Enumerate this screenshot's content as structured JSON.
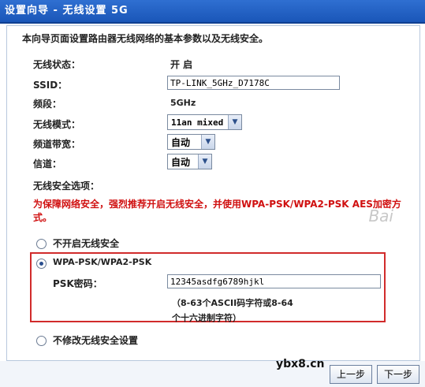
{
  "window": {
    "title": "设置向导 - 无线设置 5G"
  },
  "intro": "本向导页面设置路由器无线网络的基本参数以及无线安全。",
  "fields": {
    "status_label": "无线状态：",
    "status_value": "开 启",
    "ssid_label": "SSID：",
    "ssid_value": "TP-LINK_5GHz_D7178C",
    "band_label": "频段：",
    "band_value": "5GHz",
    "mode_label": "无线模式：",
    "mode_value": "11an mixed",
    "width_label": "频道带宽：",
    "width_value": "自动",
    "channel_label": "信道：",
    "channel_value": "自动"
  },
  "security": {
    "section_label": "无线安全选项：",
    "warning": "为保障网络安全，强烈推荐开启无线安全，并使用WPA-PSK/WPA2-PSK AES加密方式。",
    "option_off": "不开启无线安全",
    "option_wpa": "WPA-PSK/WPA2-PSK",
    "psk_label": "PSK密码：",
    "psk_value": "12345asdfg6789hjkl",
    "psk_hint_1": "（8-63个ASCII码字符或8-64",
    "psk_hint_2": "个十六进制字符）",
    "option_keep": "不修改无线安全设置",
    "selected": "wpa"
  },
  "buttons": {
    "prev": "上一步",
    "next": "下一步"
  },
  "site_text": "ybx8.cn",
  "watermark": "Bai"
}
